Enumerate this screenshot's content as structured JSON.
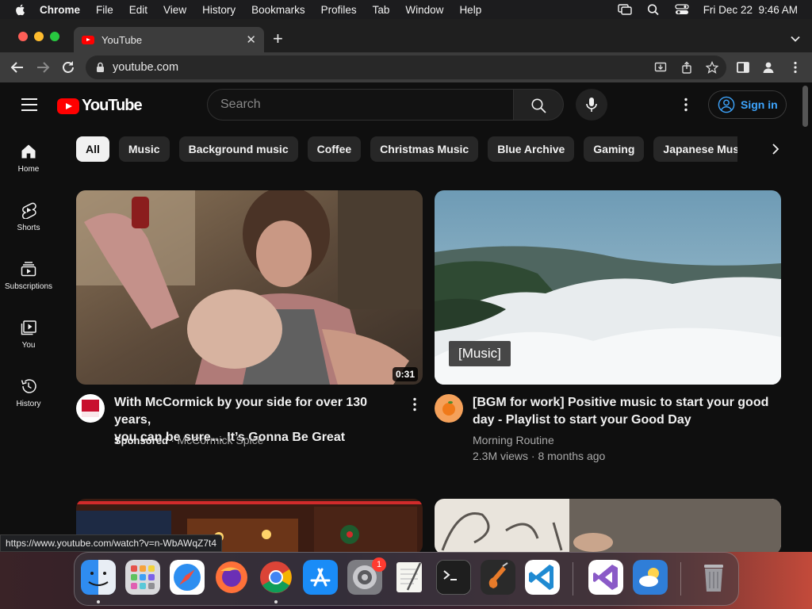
{
  "menubar": {
    "app": "Chrome",
    "items": [
      "File",
      "Edit",
      "View",
      "History",
      "Bookmarks",
      "Profiles",
      "Tab",
      "Window",
      "Help"
    ],
    "clock": "Fri Dec 22  9:46 AM"
  },
  "browser": {
    "tab_title": "YouTube",
    "new_tab": "+",
    "url": "youtube.com",
    "status_url": "https://www.youtube.com/watch?v=n-WbAWqZ7t4"
  },
  "youtube": {
    "wordmark": "YouTube",
    "search_placeholder": "Search",
    "sign_in": "Sign in",
    "rail": [
      {
        "label": "Home",
        "icon": "home-icon"
      },
      {
        "label": "Shorts",
        "icon": "shorts-icon"
      },
      {
        "label": "Subscriptions",
        "icon": "subscriptions-icon"
      },
      {
        "label": "You",
        "icon": "you-icon"
      },
      {
        "label": "History",
        "icon": "history-icon"
      }
    ],
    "chips": [
      "All",
      "Music",
      "Background music",
      "Coffee",
      "Christmas Music",
      "Blue Archive",
      "Gaming",
      "Japanese Music"
    ],
    "videos": [
      {
        "title_line1": "With McCormick by your side for over 130 years,",
        "title_line2": "you can be sure… It’s Gonna Be Great",
        "duration": "0:31",
        "sponsored": "Sponsored",
        "separator": " · ",
        "channel": "McCormick Spice"
      },
      {
        "title_line1": "[BGM for work] Positive music to start your good",
        "title_line2": "day - Playlist to start your Good Day",
        "caption": "[Music]",
        "channel": "Morning Routine",
        "stats": "2.3M views · 8 months ago"
      }
    ]
  },
  "dock": {
    "settings_badge": "1"
  },
  "colors": {
    "youtube_red": "#ff0000",
    "link_blue": "#3ea6ff",
    "page_bg": "#0f0f0f"
  }
}
